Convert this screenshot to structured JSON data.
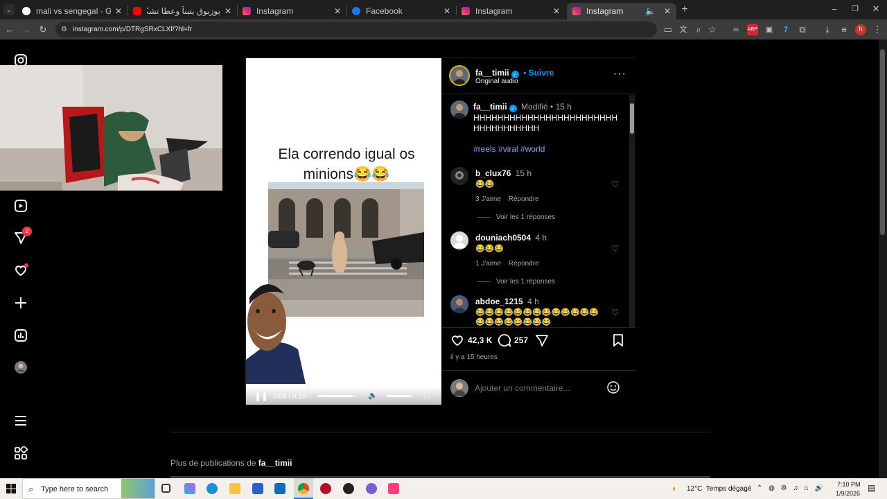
{
  "browser": {
    "tabs": [
      {
        "title": "mali vs sengegal - Google Search",
        "favicon_color": "#ffffff"
      },
      {
        "title": "بوزيوق يتبنأ وعطا تشكيلة لركراكي",
        "favicon_color": "#ff0000"
      },
      {
        "title": "Instagram",
        "favicon_color": "#e1306c"
      },
      {
        "title": "Facebook",
        "favicon_color": "#1877f2"
      },
      {
        "title": "Instagram",
        "favicon_color": "#e1306c"
      },
      {
        "title": "Instagram",
        "favicon_color": "#e1306c"
      }
    ],
    "url": "instagram.com/p/DTRgSRxCLXf/?hl=fr",
    "profile_letter": "h"
  },
  "post": {
    "overlay_text": "Ela correndo igual os minions😂😂",
    "video_time": "0:09 / 0:10",
    "video_progress": 0.9,
    "author": "fa__timii",
    "follow_label": "• Suivre",
    "audio": "Original audio",
    "caption": {
      "author": "fa__timii",
      "meta": "Modifié • 15 h",
      "text": "HHHHHHHHHHHHHHHHHHHHHHHHHHHHHHHHHHH",
      "hashtags": "#reels #viral #world"
    },
    "comments": [
      {
        "user": "b_clux76",
        "time": "15 h",
        "text": "😂😂",
        "likes": "3 J'aime",
        "reply": "Répondre",
        "view_replies": "Voir les 1 réponses"
      },
      {
        "user": "douniach0504",
        "time": "4 h",
        "text": "😂😂😂",
        "likes": "1 J'aime",
        "reply": "Répondre",
        "view_replies": "Voir les 1 réponses"
      },
      {
        "user": "abdoe_1215",
        "time": "4 h",
        "text": "😂😂😂😂😂😂😂😂😂😂😂😂😂😂😂😂😂😂😂😂😂"
      }
    ],
    "likes_count": "42,3 K",
    "comments_count": "257",
    "posted_ago": "il y a 15 heures",
    "add_comment_placeholder": "Ajouter un commentaire...",
    "notification_badge": "2"
  },
  "more_from": {
    "prefix": "Plus de publications de",
    "user": "fa__timii"
  },
  "taskbar": {
    "search_placeholder": "Type here to search",
    "weather": "12°C  Temps dégagé",
    "time": "7:10 PM",
    "date": "1/9/2026"
  }
}
